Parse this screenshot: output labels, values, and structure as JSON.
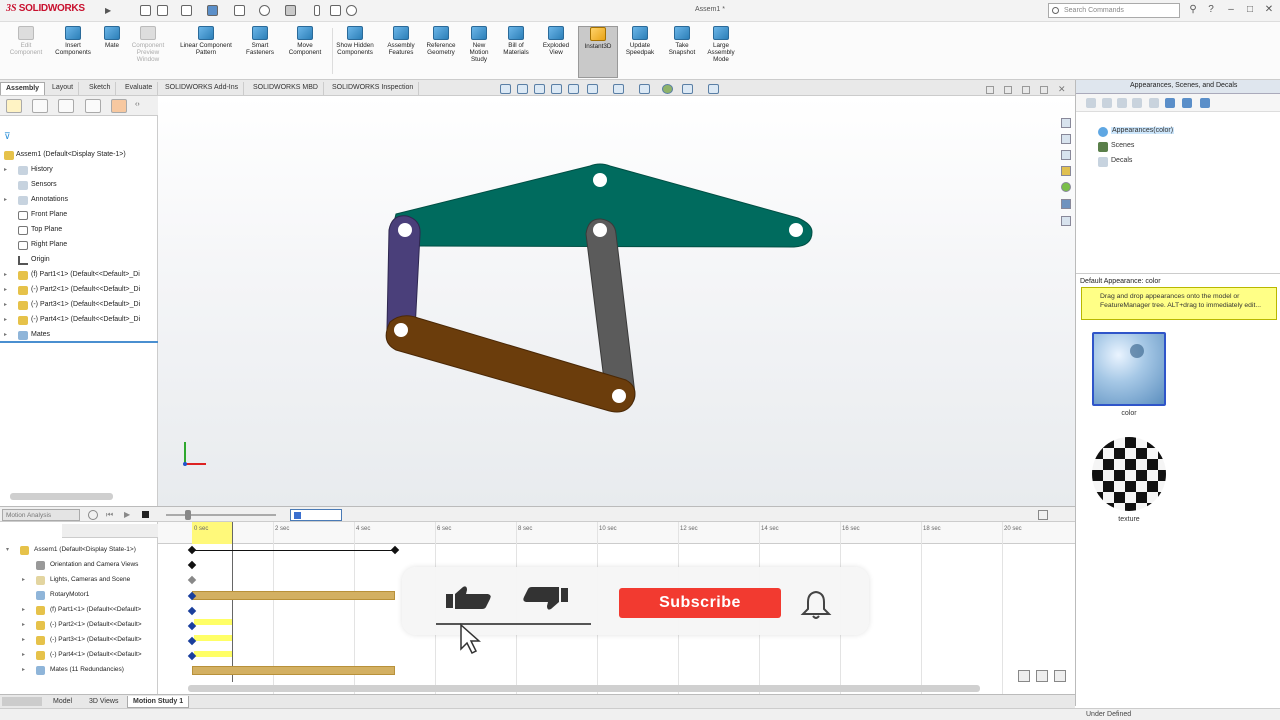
{
  "app": {
    "name": "SOLIDWORKS",
    "logo_prefix": "3S",
    "document_title": "Assem1 *",
    "search_placeholder": "Search Commands"
  },
  "command_manager": {
    "buttons": [
      {
        "label": "Edit Component",
        "enabled": false
      },
      {
        "label": "Insert Components",
        "enabled": true
      },
      {
        "label": "Mate",
        "enabled": true
      },
      {
        "label": "Component Preview Window",
        "enabled": false
      },
      {
        "label": "Linear Component Pattern",
        "enabled": true
      },
      {
        "label": "Smart Fasteners",
        "enabled": true
      },
      {
        "label": "Move Component",
        "enabled": true
      },
      {
        "label": "Show Hidden Components",
        "enabled": true
      },
      {
        "label": "Assembly Features",
        "enabled": true
      },
      {
        "label": "Reference Geometry",
        "enabled": true
      },
      {
        "label": "New Motion Study",
        "enabled": true
      },
      {
        "label": "Bill of Materials",
        "enabled": true
      },
      {
        "label": "Exploded View",
        "enabled": true
      },
      {
        "label": "Instant3D",
        "enabled": true,
        "selected": true
      },
      {
        "label": "Update Speedpak",
        "enabled": true
      },
      {
        "label": "Take Snapshot",
        "enabled": true
      },
      {
        "label": "Large Assembly Mode",
        "enabled": true
      }
    ]
  },
  "tabs": [
    "Assembly",
    "Layout",
    "Sketch",
    "Evaluate",
    "SOLIDWORKS Add-Ins",
    "SOLIDWORKS MBD",
    "SOLIDWORKS Inspection"
  ],
  "active_tab": "Assembly",
  "feature_tree": {
    "root": "Assem1  (Default<Display State-1>)",
    "items": [
      {
        "label": "History"
      },
      {
        "label": "Sensors"
      },
      {
        "label": "Annotations"
      },
      {
        "label": "Front Plane"
      },
      {
        "label": "Top Plane"
      },
      {
        "label": "Right Plane"
      },
      {
        "label": "Origin"
      },
      {
        "label": "(f) Part1<1> (Default<<Default>_Di"
      },
      {
        "label": "(-) Part2<1> (Default<<Default>_Di"
      },
      {
        "label": "(-) Part3<1> (Default<<Default>_Di"
      },
      {
        "label": "(-) Part4<1> (Default<<Default>_Di"
      },
      {
        "label": "Mates"
      }
    ]
  },
  "task_pane": {
    "title": "Appearances, Scenes, and Decals",
    "tree": [
      {
        "label": "Appearances(color)",
        "selected": true
      },
      {
        "label": "Scenes"
      },
      {
        "label": "Decals"
      }
    ],
    "default_label": "Default Appearance: color",
    "tip": "Drag and drop appearances onto the model or FeatureManager tree.  ALT+drag to immediately edit...",
    "swatches": [
      {
        "label": "color"
      },
      {
        "label": "texture"
      }
    ]
  },
  "motion_study": {
    "type": "Motion Analysis",
    "tree": [
      {
        "label": "Assem1  (Default<Display State-1>)"
      },
      {
        "label": "Orientation and Camera Views"
      },
      {
        "label": "Lights, Cameras and Scene"
      },
      {
        "label": "RotaryMotor1"
      },
      {
        "label": "(f) Part1<1> (Default<<Default>"
      },
      {
        "label": "(-) Part2<1> (Default<<Default>"
      },
      {
        "label": "(-) Part3<1> (Default<<Default>"
      },
      {
        "label": "(-) Part4<1> (Default<<Default>"
      },
      {
        "label": "Mates (11 Redundancies)"
      }
    ],
    "time_labels": [
      "0 sec",
      "2 sec",
      "4 sec",
      "6 sec",
      "8 sec",
      "10 sec",
      "12 sec",
      "14 sec",
      "16 sec",
      "18 sec",
      "20 sec"
    ]
  },
  "bottom_tabs": [
    "Model",
    "3D Views",
    "Motion Study 1"
  ],
  "active_bottom_tab": "Motion Study 1",
  "status": "Under Defined",
  "overlay": {
    "subscribe_label": "Subscribe"
  },
  "colors": {
    "link_top": "#006b5e",
    "link_left": "#4a3f7a",
    "link_right": "#5b5b5b",
    "link_bottom": "#6b3d0c",
    "subscribe_red": "#f23a30",
    "tip_yellow": "#ffff86"
  }
}
